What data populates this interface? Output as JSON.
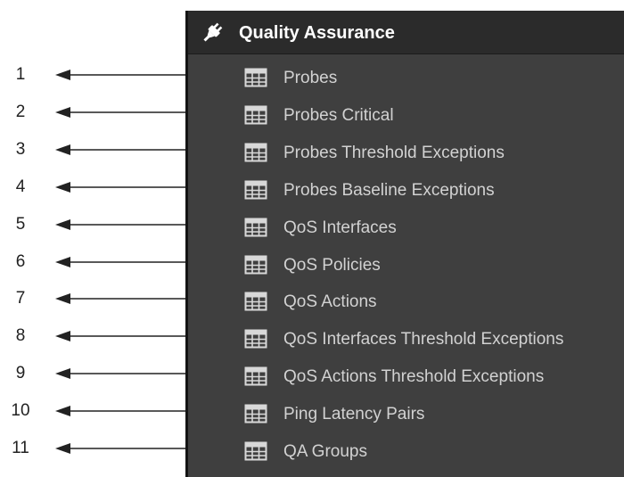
{
  "panel": {
    "title": "Quality Assurance",
    "header_icon": "plug-icon",
    "item_icon": "table-grid-icon",
    "items": [
      {
        "number": "1",
        "label": "Probes"
      },
      {
        "number": "2",
        "label": "Probes Critical"
      },
      {
        "number": "3",
        "label": "Probes Threshold Exceptions"
      },
      {
        "number": "4",
        "label": "Probes Baseline Exceptions"
      },
      {
        "number": "5",
        "label": "QoS Interfaces"
      },
      {
        "number": "6",
        "label": "QoS Policies"
      },
      {
        "number": "7",
        "label": "QoS Actions"
      },
      {
        "number": "8",
        "label": "QoS Interfaces Threshold Exceptions"
      },
      {
        "number": "9",
        "label": "QoS Actions Threshold Exceptions"
      },
      {
        "number": "10",
        "label": "Ping Latency Pairs"
      },
      {
        "number": "11",
        "label": "QA Groups"
      }
    ]
  },
  "colors": {
    "panel_bg": "#3f3f3f",
    "header_bg": "#2b2b2b",
    "item_text": "#d2d2d2",
    "title_text": "#ffffff",
    "callout_text": "#222222"
  }
}
